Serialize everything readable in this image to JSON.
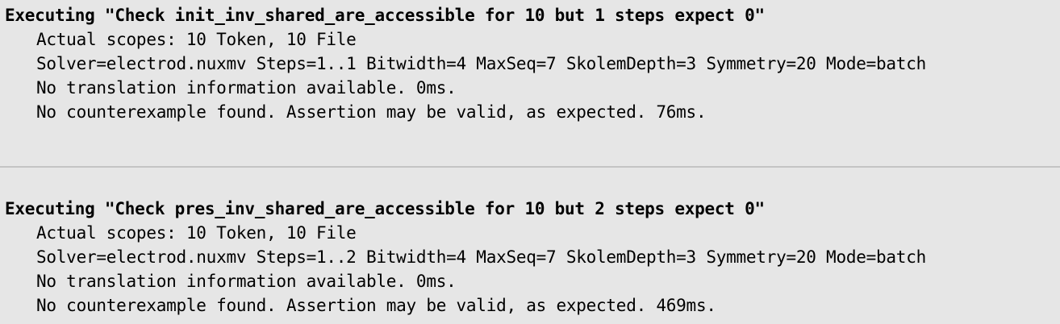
{
  "log": {
    "runs": [
      {
        "heading": "Executing \"Check init_inv_shared_are_accessible for 10 but 1 steps expect 0\"",
        "scopes": "Actual scopes: 10 Token, 10 File",
        "solver": "Solver=electrod.nuxmv Steps=1..1 Bitwidth=4 MaxSeq=7 SkolemDepth=3 Symmetry=20 Mode=batch",
        "translation": "No translation information available. 0ms.",
        "result": "No counterexample found. Assertion may be valid, as expected. 76ms."
      },
      {
        "heading": "Executing \"Check pres_inv_shared_are_accessible for 10 but 2 steps expect 0\"",
        "scopes": "Actual scopes: 10 Token, 10 File",
        "solver": "Solver=electrod.nuxmv Steps=1..2 Bitwidth=4 MaxSeq=7 SkolemDepth=3 Symmetry=20 Mode=batch",
        "translation": "No translation information available. 0ms.",
        "result": "No counterexample found. Assertion may be valid, as expected. 469ms."
      }
    ]
  },
  "colors": {
    "background": "#e6e6e6",
    "text": "#000000",
    "separator": "#c4c4c4"
  }
}
